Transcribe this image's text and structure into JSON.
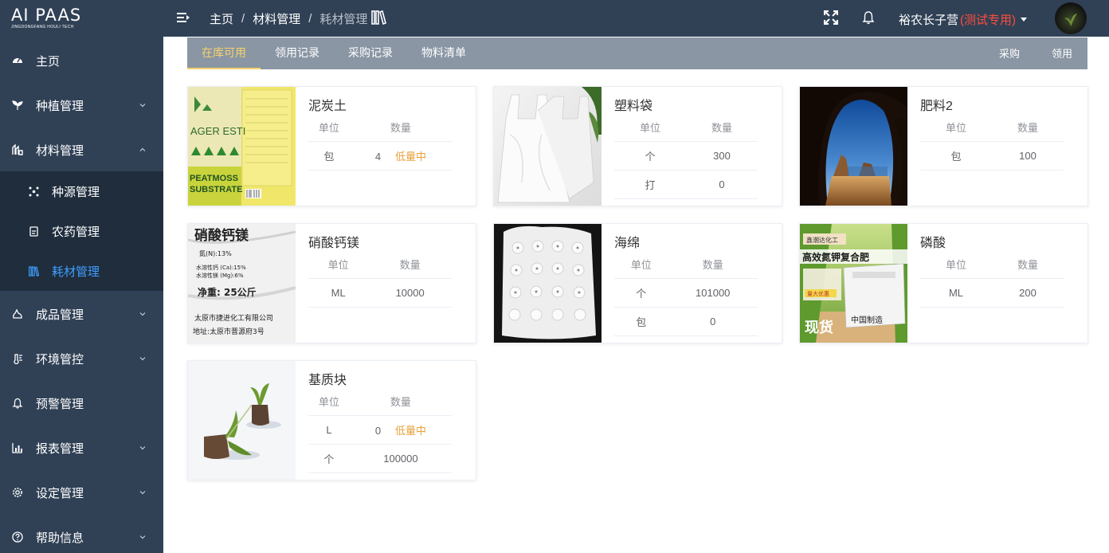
{
  "logo": {
    "text": "AI PAAS",
    "subtext": "JINGDONGFANG HOULI TECH"
  },
  "breadcrumb": {
    "items": [
      "主页",
      "材料管理",
      "耗材管理"
    ],
    "separator": "/"
  },
  "user": {
    "name": "裕农长子营",
    "tag": "(测试专用)"
  },
  "sidebar": {
    "items": [
      {
        "label": "主页",
        "icon": "dashboard-icon"
      },
      {
        "label": "种植管理",
        "icon": "sprout-icon"
      },
      {
        "label": "材料管理",
        "icon": "flask-icon"
      },
      {
        "label": "成品管理",
        "icon": "bag-icon"
      },
      {
        "label": "环境管控",
        "icon": "thermometer-icon"
      },
      {
        "label": "预警管理",
        "icon": "bell-icon"
      },
      {
        "label": "报表管理",
        "icon": "bar-chart-icon"
      },
      {
        "label": "设定管理",
        "icon": "gear-icon"
      },
      {
        "label": "帮助信息",
        "icon": "help-icon"
      }
    ],
    "submenu": [
      {
        "label": "种源管理",
        "icon": "seed-icon"
      },
      {
        "label": "农药管理",
        "icon": "pesticide-icon"
      },
      {
        "label": "耗材管理",
        "icon": "books-icon"
      }
    ]
  },
  "tabs": [
    "在库可用",
    "领用记录",
    "采购记录",
    "物料清单"
  ],
  "actions": {
    "purchase": "采购",
    "requisition": "领用"
  },
  "table_headers": {
    "unit": "单位",
    "quantity": "数量"
  },
  "low_stock_label": "低量中",
  "materials": [
    {
      "name": "泥炭土",
      "rows": [
        {
          "unit": "包",
          "qty": "4",
          "low": true
        }
      ]
    },
    {
      "name": "塑料袋",
      "rows": [
        {
          "unit": "个",
          "qty": "300",
          "low": false
        },
        {
          "unit": "打",
          "qty": "0",
          "low": false
        }
      ]
    },
    {
      "name": "肥料2",
      "rows": [
        {
          "unit": "包",
          "qty": "100",
          "low": false
        }
      ]
    },
    {
      "name": "硝酸钙镁",
      "rows": [
        {
          "unit": "ML",
          "qty": "10000",
          "low": false
        }
      ]
    },
    {
      "name": "海绵",
      "rows": [
        {
          "unit": "个",
          "qty": "101000",
          "low": false
        },
        {
          "unit": "包",
          "qty": "0",
          "low": false
        }
      ]
    },
    {
      "name": "磷酸",
      "rows": [
        {
          "unit": "ML",
          "qty": "200",
          "low": false
        }
      ]
    },
    {
      "name": "基质块",
      "rows": [
        {
          "unit": "L",
          "qty": "0",
          "low": true
        },
        {
          "unit": "个",
          "qty": "100000",
          "low": false
        }
      ]
    }
  ],
  "image_text": {
    "peat": [
      "AGER ESTI",
      "PEATMOSS",
      "SUBSTRATE"
    ],
    "nitrate": [
      "硝酸钙镁",
      "氮(N):13%",
      "水溶性钙 (Ca):15%",
      "水溶性镁 (Mg):6%",
      "净重: 25公斤",
      "太原市捷进化工有限公司",
      "地址:太原市晋源府3号"
    ],
    "phos": [
      "鑫潮达化工",
      "高效氮钾复合肥",
      "量大优惠",
      "现货",
      "中国制造"
    ]
  }
}
